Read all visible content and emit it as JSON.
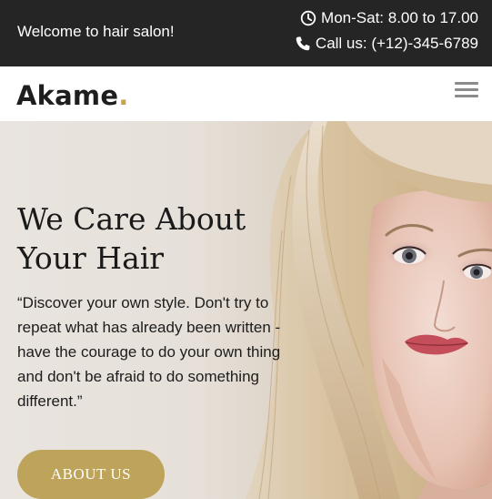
{
  "topbar": {
    "welcome": "Welcome to hair salon!",
    "hours": "Mon-Sat: 8.00 to 17.00",
    "phone": "Call us: (+12)-345-6789",
    "hours_icon": "clock-icon",
    "phone_icon": "phone-icon"
  },
  "header": {
    "logo_text": "Akame",
    "logo_dot": ".",
    "menu_icon": "hamburger-menu-icon"
  },
  "hero": {
    "title_line1": "We Care About",
    "title_line2": "Your Hair",
    "quote": "“Discover your own style. Don't try to repeat what has already been written - have the courage to do your own thing and don't be afraid to do something different.”",
    "button_label": "ABOUT US"
  },
  "colors": {
    "topbar_bg": "#252525",
    "accent_gold": "#bea35a",
    "logo_dot": "#c9a44a",
    "text_dark": "#1a1a1a"
  }
}
